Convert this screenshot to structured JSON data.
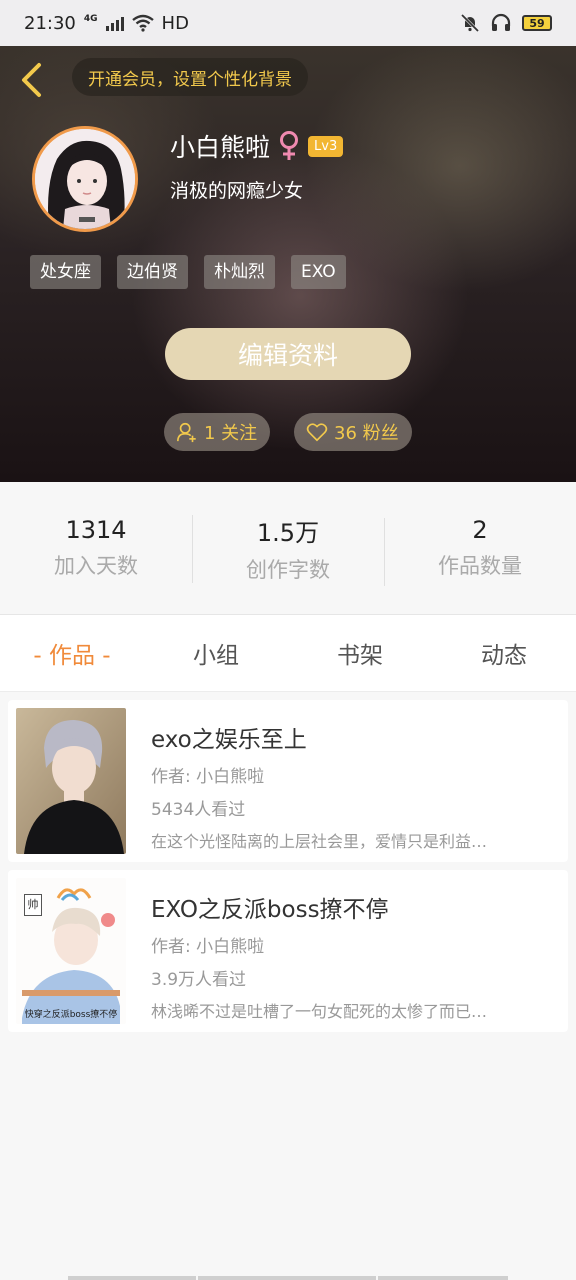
{
  "status_bar": {
    "time": "21:30",
    "network": "4G",
    "hd": "HD",
    "battery": "59"
  },
  "header": {
    "vip_prompt": "开通会员，设置个性化背景"
  },
  "profile": {
    "name": "小白熊啦",
    "gender_symbol": "♀",
    "level": "Lv3",
    "bio": "消极的网瘾少女",
    "tags": [
      "处女座",
      "边伯贤",
      "朴灿烈",
      "EXO"
    ],
    "edit_label": "编辑资料",
    "follow_label": "1 关注",
    "fans_label": "36 粉丝"
  },
  "stats": [
    {
      "value": "1314",
      "label": "加入天数"
    },
    {
      "value": "1.5万",
      "label": "创作字数"
    },
    {
      "value": "2",
      "label": "作品数量"
    }
  ],
  "tabs": [
    "- 作品 -",
    "小组",
    "书架",
    "动态"
  ],
  "works": [
    {
      "title": "exo之娱乐至上",
      "author": "作者: 小白熊啦",
      "views": "5434人看过",
      "desc": "在这个光怪陆离的上层社会里，爱情只是利益…"
    },
    {
      "title": "EXO之反派boss撩不停",
      "author": "作者: 小白熊啦",
      "views": "3.9万人看过",
      "desc": "林浅晞不过是吐槽了一句女配死的太惨了而已…",
      "cover_text": "快穿之反派boss撩不停",
      "cover_badge": "帅"
    }
  ],
  "colors": {
    "accent": "#f08a3a",
    "gold": "#f2c94c",
    "edit_button": "#e5d7b4",
    "level_badge": "#f2b632"
  }
}
